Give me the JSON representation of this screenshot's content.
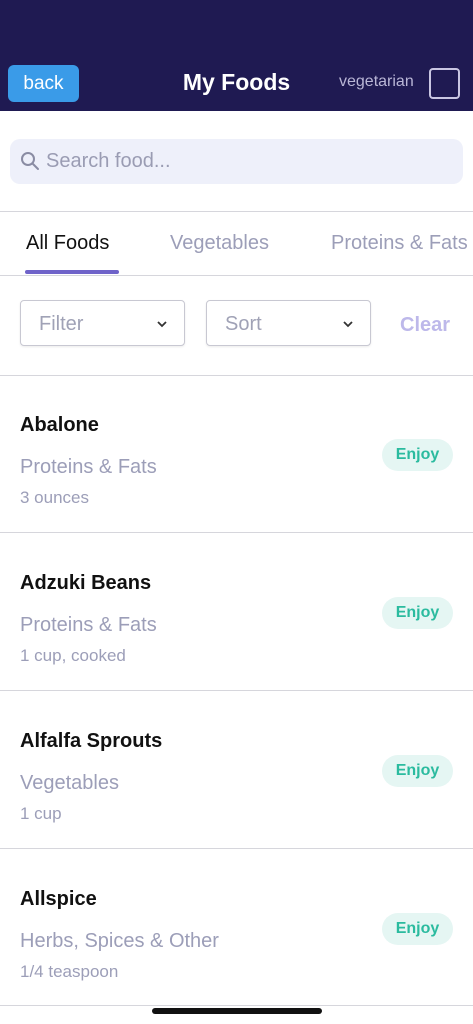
{
  "header": {
    "back_label": "back",
    "title": "My Foods",
    "vegetarian_label": "vegetarian",
    "vegetarian_checked": false
  },
  "search": {
    "placeholder": "Search food..."
  },
  "tabs": [
    {
      "label": "All Foods",
      "active": true
    },
    {
      "label": "Vegetables",
      "active": false
    },
    {
      "label": "Proteins & Fats",
      "active": false
    }
  ],
  "controls": {
    "filter_label": "Filter",
    "sort_label": "Sort",
    "clear_label": "Clear"
  },
  "foods": [
    {
      "name": "Abalone",
      "category": "Proteins & Fats",
      "portion": "3 ounces",
      "status": "Enjoy"
    },
    {
      "name": "Adzuki Beans",
      "category": "Proteins & Fats",
      "portion": "1 cup, cooked",
      "status": "Enjoy"
    },
    {
      "name": "Alfalfa Sprouts",
      "category": "Vegetables",
      "portion": "1 cup",
      "status": "Enjoy"
    },
    {
      "name": "Allspice",
      "category": "Herbs, Spices & Other",
      "portion": "1/4 teaspoon",
      "status": "Enjoy"
    }
  ],
  "colors": {
    "header_bg": "#1f1a52",
    "back_button": "#3a9be8",
    "tab_underline": "#6f63c9",
    "badge_bg": "#e5f6f3",
    "badge_text": "#2bbb9f"
  }
}
